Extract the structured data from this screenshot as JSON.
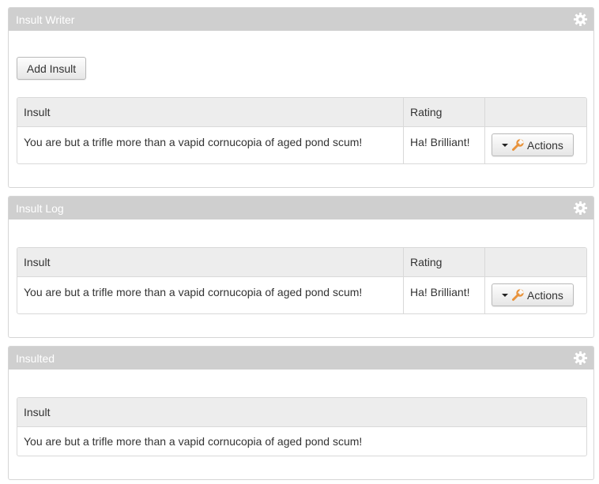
{
  "panels": [
    {
      "title": "Insult Writer",
      "add_button": "Add Insult",
      "columns": [
        "Insult",
        "Rating"
      ],
      "rows": [
        {
          "insult": "You are but a trifle more than a vapid cornucopia of aged pond scum!",
          "rating": "Ha! Brilliant!",
          "action": "Actions"
        }
      ]
    },
    {
      "title": "Insult Log",
      "columns": [
        "Insult",
        "Rating"
      ],
      "rows": [
        {
          "insult": "You are but a trifle more than a vapid cornucopia of aged pond scum!",
          "rating": "Ha! Brilliant!",
          "action": "Actions"
        }
      ]
    },
    {
      "title": "Insulted",
      "columns": [
        "Insult"
      ],
      "rows": [
        {
          "insult": "You are but a trifle more than a vapid cornucopia of aged pond scum!"
        }
      ]
    }
  ],
  "icons": {
    "panel_settings": "gear-icon",
    "actions_dropdown": "caret-down-icon",
    "actions": "wrench-icon"
  },
  "colors": {
    "header_bg": "#cfcfcf",
    "header_text": "#ffffff",
    "table_header_bg": "#ededed",
    "wrench": "#e8923a"
  }
}
